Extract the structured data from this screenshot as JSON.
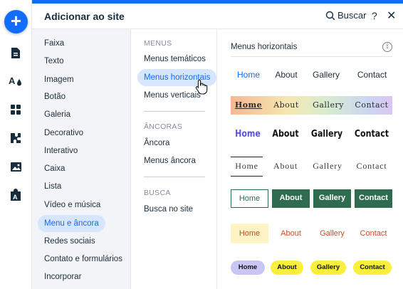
{
  "header": {
    "title": "Adicionar ao site",
    "search_label": "Buscar",
    "help_label": "?",
    "close_label": "✕"
  },
  "rail": {
    "add_label": "+",
    "icons": [
      "pages-icon",
      "design-icon",
      "apps-icon",
      "plugins-icon",
      "media-icon",
      "business-icon"
    ]
  },
  "categories": [
    {
      "label": "Faixa"
    },
    {
      "label": "Texto"
    },
    {
      "label": "Imagem"
    },
    {
      "label": "Botão"
    },
    {
      "label": "Galeria"
    },
    {
      "label": "Decorativo"
    },
    {
      "label": "Interativo"
    },
    {
      "label": "Caixa"
    },
    {
      "label": "Lista"
    },
    {
      "label": "Vídeo e música"
    },
    {
      "label": "Menu e âncora",
      "active": true
    },
    {
      "label": "Redes sociais"
    },
    {
      "label": "Contato e formulários"
    },
    {
      "label": "Incorporar"
    }
  ],
  "subsections": [
    {
      "title": "MENUS",
      "items": [
        {
          "label": "Menus temáticos"
        },
        {
          "label": "Menus horizontais",
          "active": true
        },
        {
          "label": "Menus verticais"
        }
      ]
    },
    {
      "title": "ÂNCORAS",
      "items": [
        {
          "label": "Âncora"
        },
        {
          "label": "Menus âncora"
        }
      ]
    },
    {
      "title": "BUSCA",
      "items": [
        {
          "label": "Busca no site"
        }
      ]
    }
  ],
  "preview": {
    "title": "Menus horizontais",
    "info_label": "i",
    "menu_items": [
      "Home",
      "About",
      "Gallery",
      "Contact"
    ]
  },
  "colors": {
    "accent": "#116dff",
    "active_bg": "#d6e6fe",
    "green": "#2f6b4f",
    "yellow": "#f9ef3c",
    "lavender": "#c9c6f6"
  }
}
